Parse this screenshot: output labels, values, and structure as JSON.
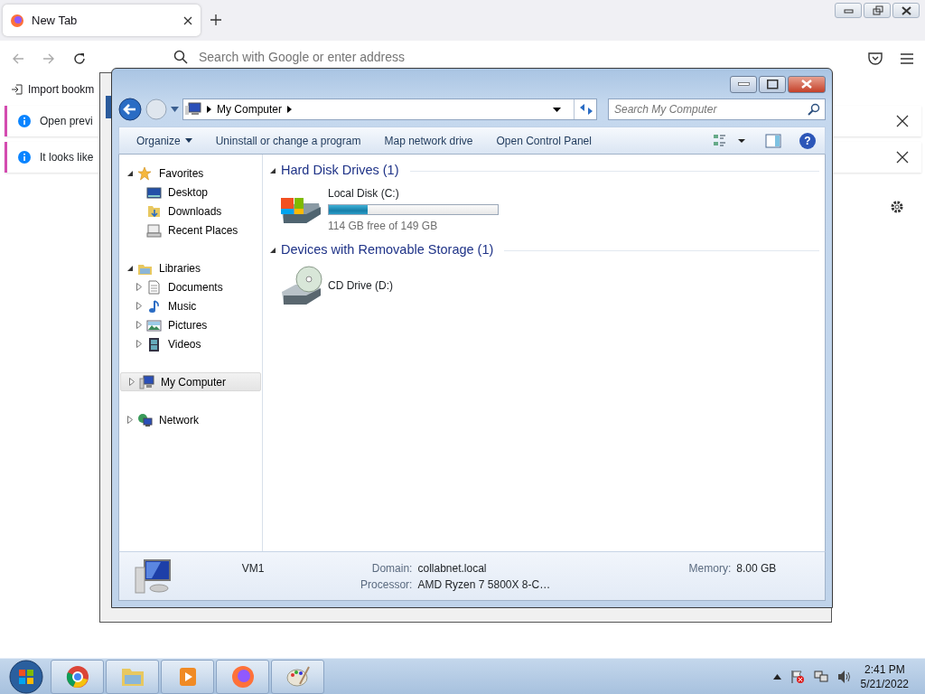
{
  "browser": {
    "tabs": [
      {
        "label": "New Tab",
        "selected": true
      }
    ],
    "address_bar": {
      "placeholder": "Search with Google or enter address"
    },
    "bookmarks_bar": {
      "import_label": "Import bookm"
    },
    "notifications": [
      {
        "text": "Open previ"
      },
      {
        "text": "It looks like"
      }
    ]
  },
  "explorer": {
    "breadcrumb": [
      "My Computer"
    ],
    "search": {
      "placeholder": "Search My Computer"
    },
    "help_button": "?",
    "commands": [
      {
        "label": "Organize",
        "kind": "menu"
      },
      {
        "label": "Uninstall or change a program",
        "kind": "action"
      },
      {
        "label": "Map network drive",
        "kind": "action"
      },
      {
        "label": "Open Control Panel",
        "kind": "action"
      }
    ],
    "nav": [
      {
        "label": "Favorites",
        "expanded": true,
        "selected": false,
        "children": [
          {
            "label": "Desktop",
            "selected": false
          },
          {
            "label": "Downloads",
            "selected": false
          },
          {
            "label": "Recent Places",
            "selected": false
          }
        ]
      },
      {
        "label": "Libraries",
        "expanded": true,
        "selected": false,
        "children": [
          {
            "label": "Documents",
            "expanded": false,
            "selected": false
          },
          {
            "label": "Music",
            "expanded": false,
            "selected": false
          },
          {
            "label": "Pictures",
            "expanded": false,
            "selected": false
          },
          {
            "label": "Videos",
            "expanded": false,
            "selected": false
          }
        ]
      },
      {
        "label": "My Computer",
        "expanded": false,
        "selected": true
      },
      {
        "label": "Network",
        "expanded": false,
        "selected": false
      }
    ],
    "groups": [
      {
        "title": "Hard Disk Drives (1)",
        "expanded": true,
        "items": [
          {
            "kind": "disk",
            "name": "Local Disk (C:)",
            "level": 0.23,
            "reading": "114 GB free of 149 GB"
          }
        ]
      },
      {
        "title": "Devices with Removable Storage (1)",
        "expanded": true,
        "items": [
          {
            "kind": "cd",
            "name": "CD Drive (D:)"
          }
        ]
      }
    ],
    "details": {
      "name": "VM1",
      "fields": [
        {
          "label": "Domain:",
          "value": "collabnet.local"
        },
        {
          "label": "Memory:",
          "value": "8.00 GB"
        },
        {
          "label": "Processor:",
          "value": "AMD Ryzen 7 5800X 8-C…"
        }
      ]
    }
  },
  "taskbar": {
    "time": "2:41 PM",
    "date": "5/21/2022"
  }
}
